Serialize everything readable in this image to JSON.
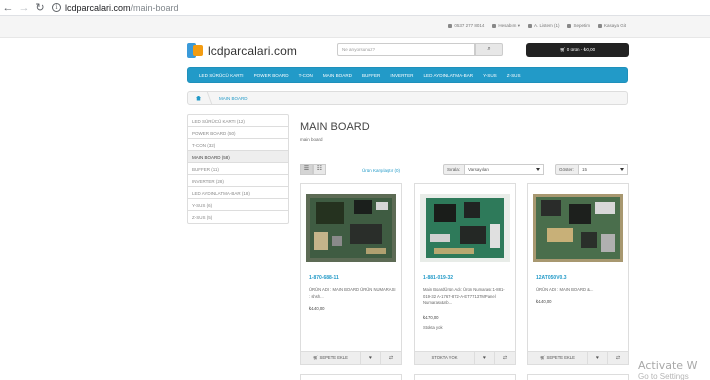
{
  "browser": {
    "domain": "lcdparcalari.com",
    "path": "/main-board"
  },
  "topbar": {
    "phone": "0537 277 8014",
    "account": "Hesabım",
    "wishlist": "A. Listem (1)",
    "cart": "Sepetim",
    "checkout": "Kasaya Git"
  },
  "header": {
    "logo_text": "lcdparcalari.com",
    "search_placeholder": "Ne arıyorsunuz?",
    "cart_button": "0 ürün - ₺0,00"
  },
  "menu": [
    "LED SÜRÜCÜ KARTI",
    "POWER BOARD",
    "T-CON",
    "MAIN BOARD",
    "BUFFER",
    "INVERTER",
    "LED AYDINLATMA-BAR",
    "Y-SUS",
    "Z-SUS"
  ],
  "breadcrumb": {
    "current": "MAIN BOARD"
  },
  "sidebar": {
    "items": [
      {
        "label": "LED SÜRÜCÜ KARTI (12)",
        "active": false
      },
      {
        "label": "POWER BOARD (50)",
        "active": false
      },
      {
        "label": "T-CON (32)",
        "active": false
      },
      {
        "label": "MAIN BOARD (58)",
        "active": true
      },
      {
        "label": "BUFFER (11)",
        "active": false
      },
      {
        "label": "INVERTER (28)",
        "active": false
      },
      {
        "label": "LED AYDINLATMA-BAR (18)",
        "active": false
      },
      {
        "label": "Y-SUS (6)",
        "active": false
      },
      {
        "label": "Z-SUS (5)",
        "active": false
      }
    ]
  },
  "content": {
    "title": "MAIN BOARD",
    "subtitle": "main board",
    "compare_link": "Ürün Karşılaştır (0)",
    "sort_label": "Sırala:",
    "sort_value": "Varsayılan",
    "limit_label": "Göster:",
    "limit_value": "15"
  },
  "products": [
    {
      "name": "1-870-688-11",
      "desc": "ÜRÜN ADI : MAIN BOARD ÜRÜN NUMARASI : shsh...",
      "price": "₺140,00",
      "stock": "",
      "cart_label": "SEPETE EKLE"
    },
    {
      "name": "1-881-019-32",
      "desc": "Main BoardÜrün Adı: Ürün Numarası:1-881-019-32 A-1767-872-A-ET77137MPanel Numarası&nb...",
      "price": "₺170,00",
      "stock": "Stokta yok",
      "cart_label": "STOKTA YOK"
    },
    {
      "name": "12AT050V0.3",
      "desc": "ÜRÜN ADI : MAIN BOARD &...",
      "price": "₺140,00",
      "stock": "",
      "cart_label": "SEPETE EKLE"
    }
  ],
  "watermark": {
    "line1": "Activate W",
    "line2": "Go to Settings"
  },
  "colors": {
    "brand": "#229ac8",
    "menu_bg": "#229ac8",
    "cart_bg": "#222222"
  }
}
